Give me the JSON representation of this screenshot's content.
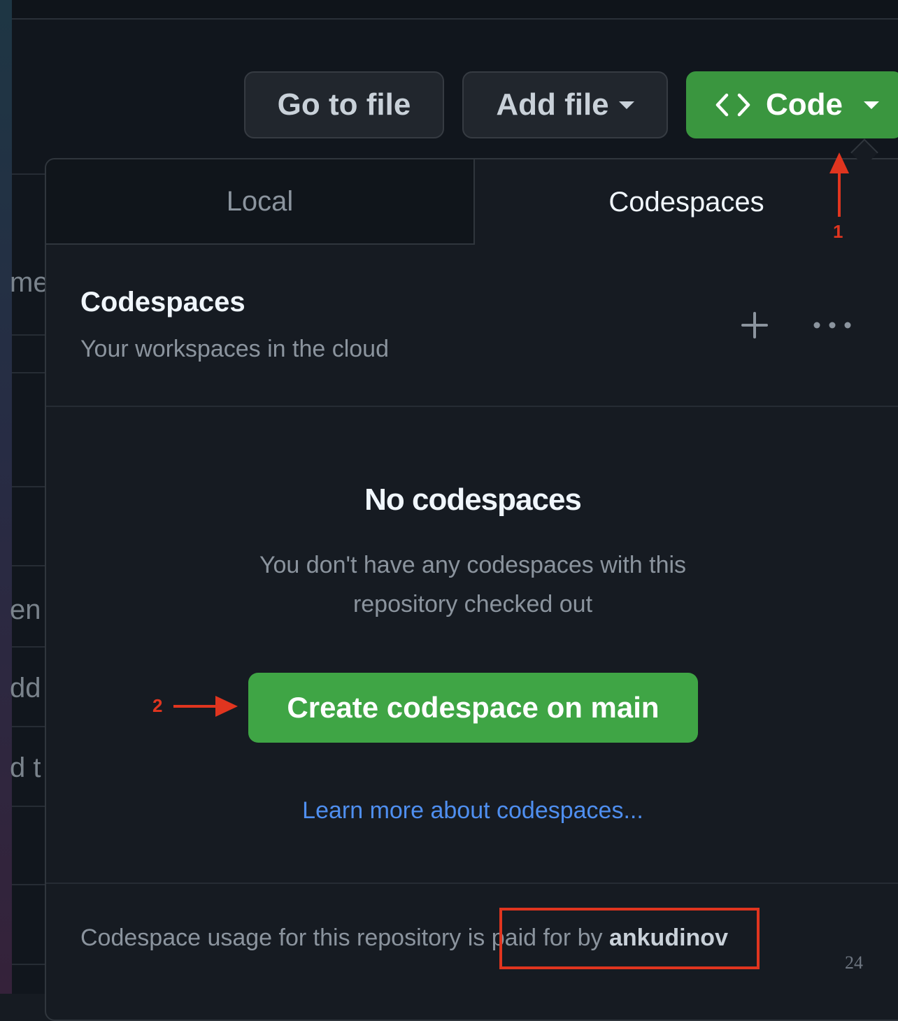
{
  "background_text": [
    "me",
    "en",
    "dd",
    "d t"
  ],
  "toolbar": {
    "go_to_file_label": "Go to file",
    "add_file_label": "Add file",
    "code_label": "Code"
  },
  "tabs": {
    "local_label": "Local",
    "codespaces_label": "Codespaces"
  },
  "section": {
    "title": "Codespaces",
    "subtitle": "Your workspaces in the cloud"
  },
  "empty_state": {
    "title": "No codespaces",
    "description_line1": "You don't have any codespaces with this",
    "description_line2": "repository checked out"
  },
  "create_button_label": "Create codespace on main",
  "learn_more_label": "Learn more about codespaces...",
  "footer": {
    "prefix": "Codespace usage for this repository is ",
    "middle": "paid for by ",
    "user": "ankudinov"
  },
  "annotations": {
    "step1": "1",
    "step2": "2",
    "color": "#e0351f"
  },
  "page_number": "24",
  "colors": {
    "accent_green": "#3fa545",
    "link_blue": "#4f8ff0",
    "panel_bg": "#161b22"
  }
}
